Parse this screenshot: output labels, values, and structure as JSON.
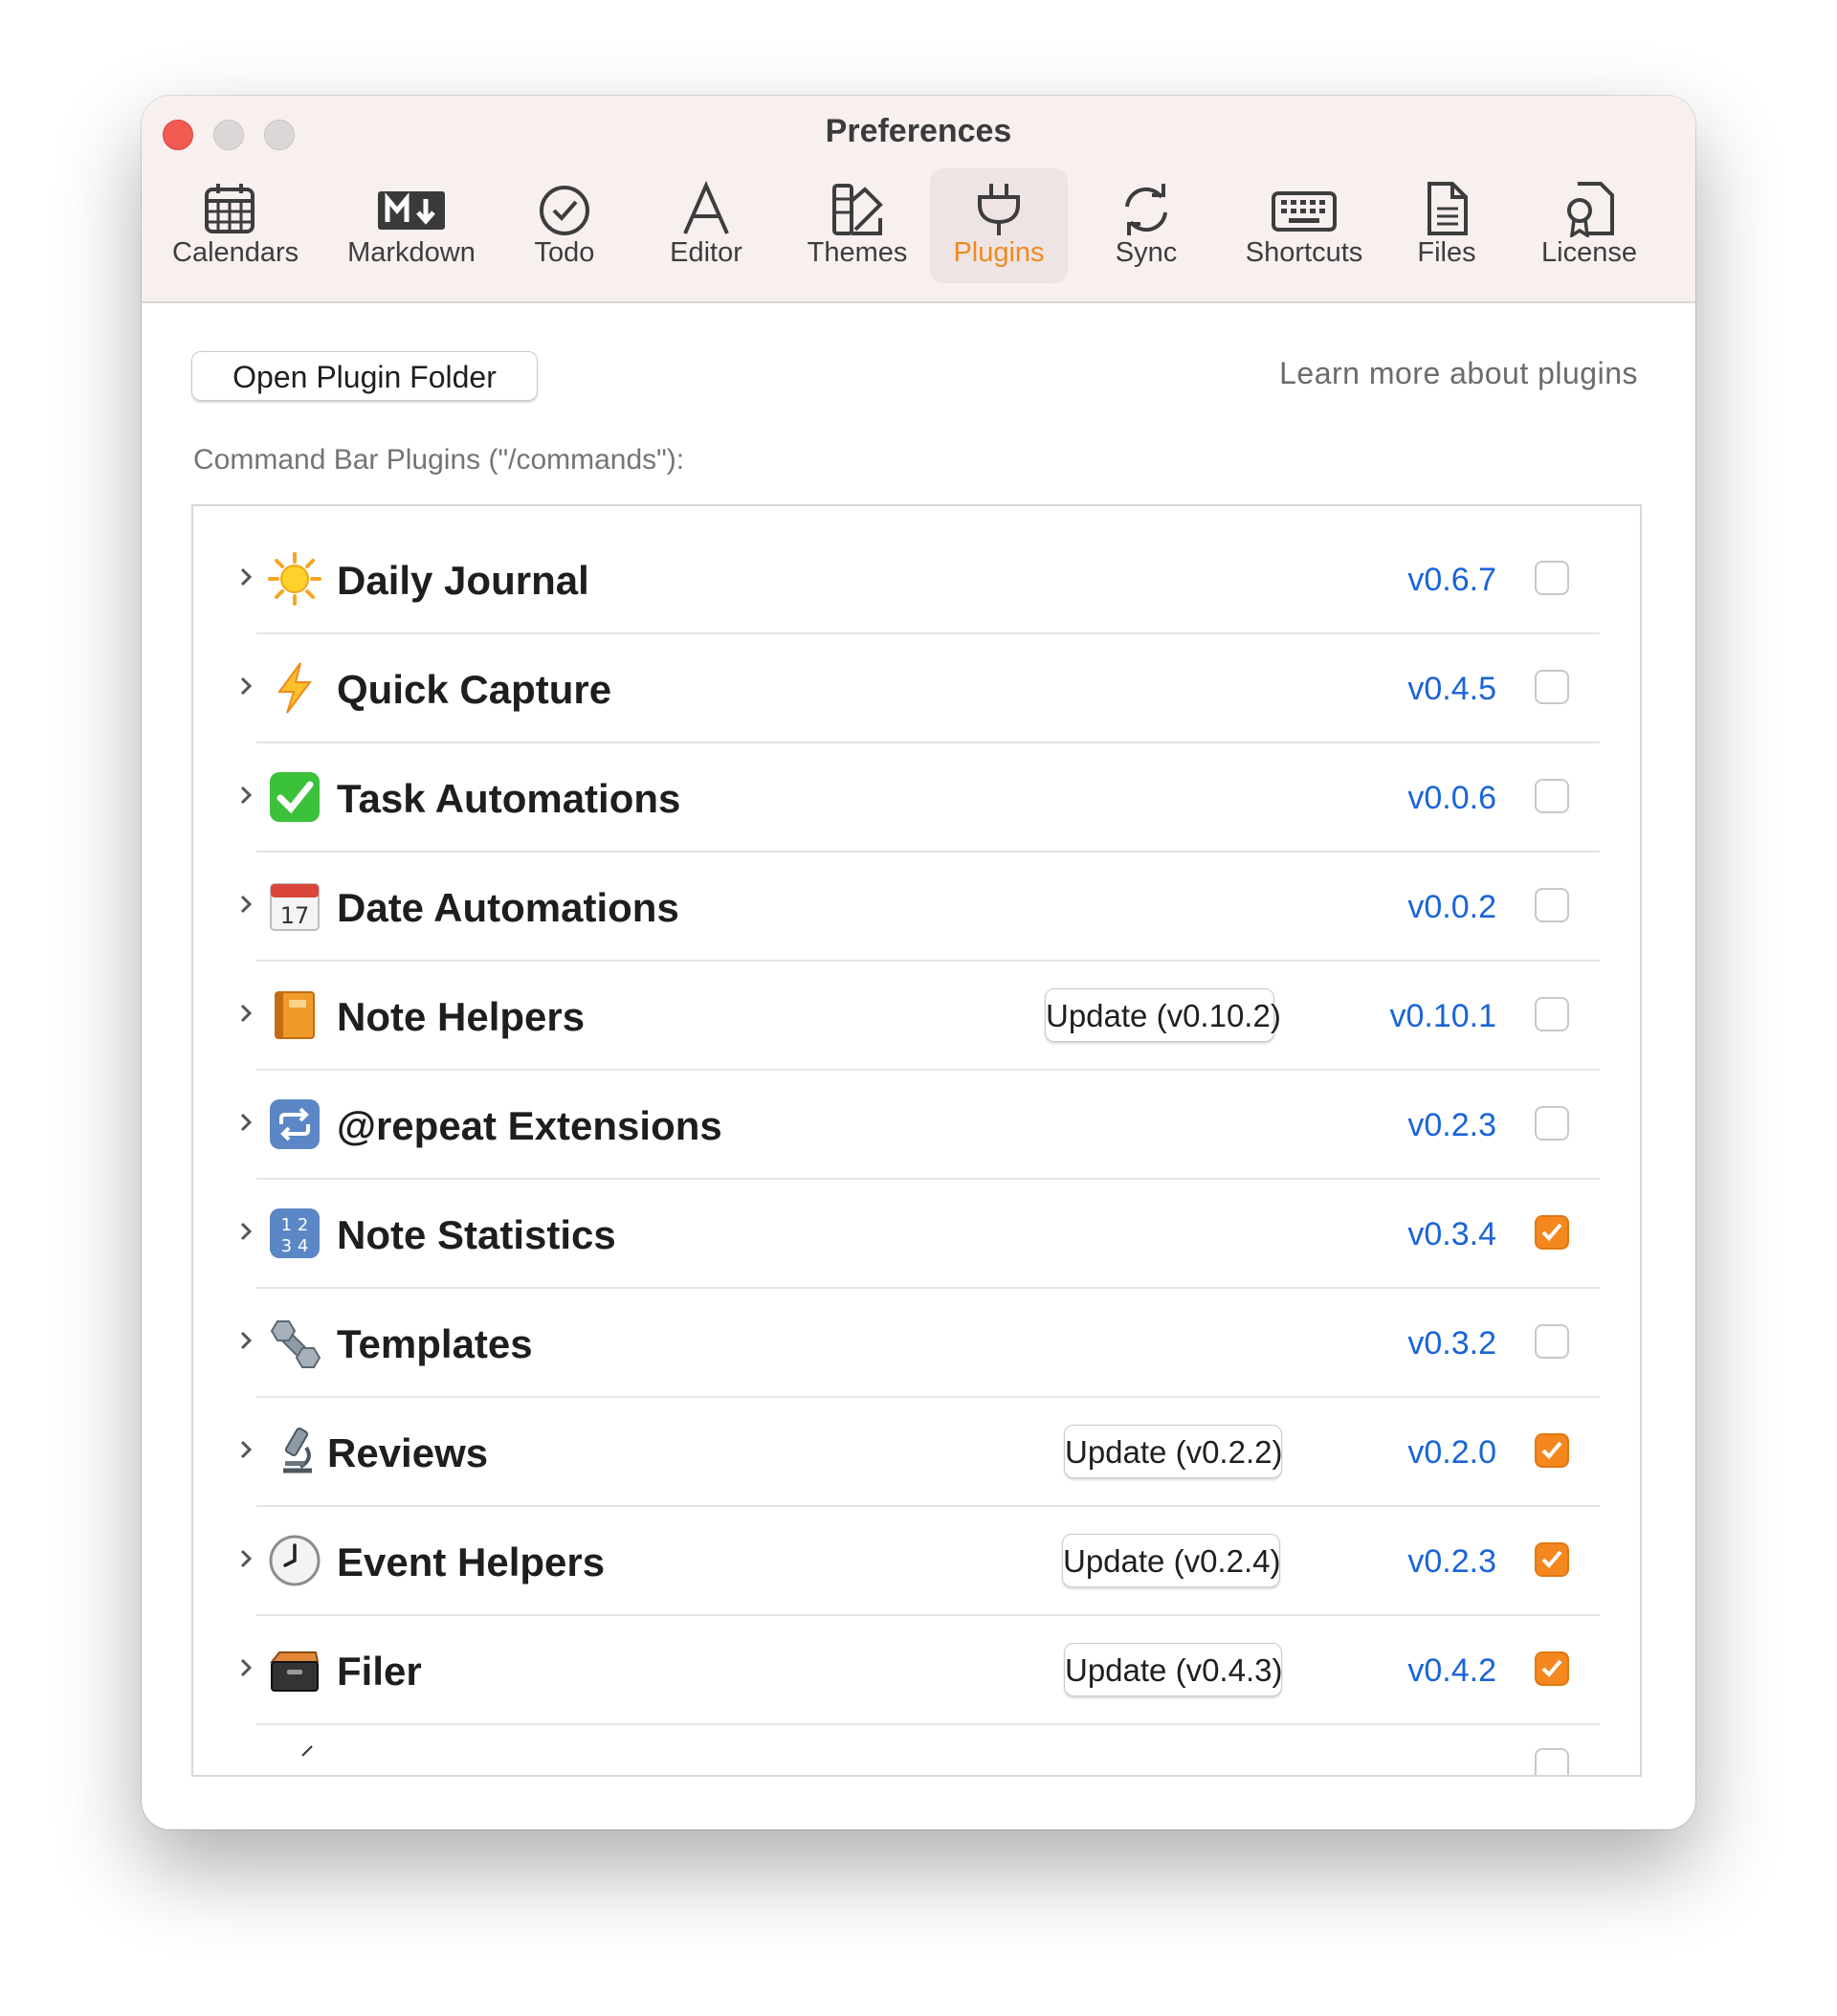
{
  "window": {
    "title": "Preferences"
  },
  "tabs": [
    {
      "label": "Calendars",
      "icon": "calendar-icon",
      "active": false
    },
    {
      "label": "Markdown",
      "icon": "markdown-icon",
      "active": false
    },
    {
      "label": "Todo",
      "icon": "todo-check-icon",
      "active": false
    },
    {
      "label": "Editor",
      "icon": "editor-letter-icon",
      "active": false
    },
    {
      "label": "Themes",
      "icon": "themes-swatch-icon",
      "active": false
    },
    {
      "label": "Plugins",
      "icon": "plug-icon",
      "active": true
    },
    {
      "label": "Sync",
      "icon": "sync-icon",
      "active": false
    },
    {
      "label": "Shortcuts",
      "icon": "keyboard-icon",
      "active": false
    },
    {
      "label": "Files",
      "icon": "file-icon",
      "active": false
    },
    {
      "label": "License",
      "icon": "license-icon",
      "active": false
    }
  ],
  "toolbar": {
    "open_folder_label": "Open Plugin Folder",
    "learn_more_label": "Learn more about plugins"
  },
  "section": {
    "label": "Command Bar Plugins (\"/commands\"):"
  },
  "plugins": [
    {
      "name": "Daily Journal",
      "icon": "sun-icon",
      "version": "v0.6.7",
      "update": "",
      "enabled": false
    },
    {
      "name": "Quick Capture",
      "icon": "lightning-icon",
      "version": "v0.4.5",
      "update": "",
      "enabled": false
    },
    {
      "name": "Task Automations",
      "icon": "check-mark-icon",
      "version": "v0.0.6",
      "update": "",
      "enabled": false
    },
    {
      "name": "Date Automations",
      "icon": "calendar-17-icon",
      "version": "v0.0.2",
      "update": "",
      "enabled": false
    },
    {
      "name": "Note Helpers",
      "icon": "notebook-icon",
      "version": "v0.10.1",
      "update": "Update (v0.10.2)",
      "enabled": false
    },
    {
      "name": "@repeat Extensions",
      "icon": "repeat-icon",
      "version": "v0.2.3",
      "update": "",
      "enabled": false
    },
    {
      "name": "Note Statistics",
      "icon": "numbers-icon",
      "version": "v0.3.4",
      "update": "",
      "enabled": true
    },
    {
      "name": "Templates",
      "icon": "bolt-nut-icon",
      "version": "v0.3.2",
      "update": "",
      "enabled": false
    },
    {
      "name": "Reviews",
      "icon": "microscope-icon",
      "version": "v0.2.0",
      "update": "Update (v0.2.2)",
      "enabled": true
    },
    {
      "name": "Event Helpers",
      "icon": "clock-icon",
      "version": "v0.2.3",
      "update": "Update (v0.2.4)",
      "enabled": true
    },
    {
      "name": "Filer",
      "icon": "file-cabinet-icon",
      "version": "v0.4.2",
      "update": "Update (v0.4.3)",
      "enabled": true
    }
  ],
  "colors": {
    "accent": "#f08a1c",
    "version_link": "#1a64d8",
    "checkbox_checked": "#f5871f"
  }
}
